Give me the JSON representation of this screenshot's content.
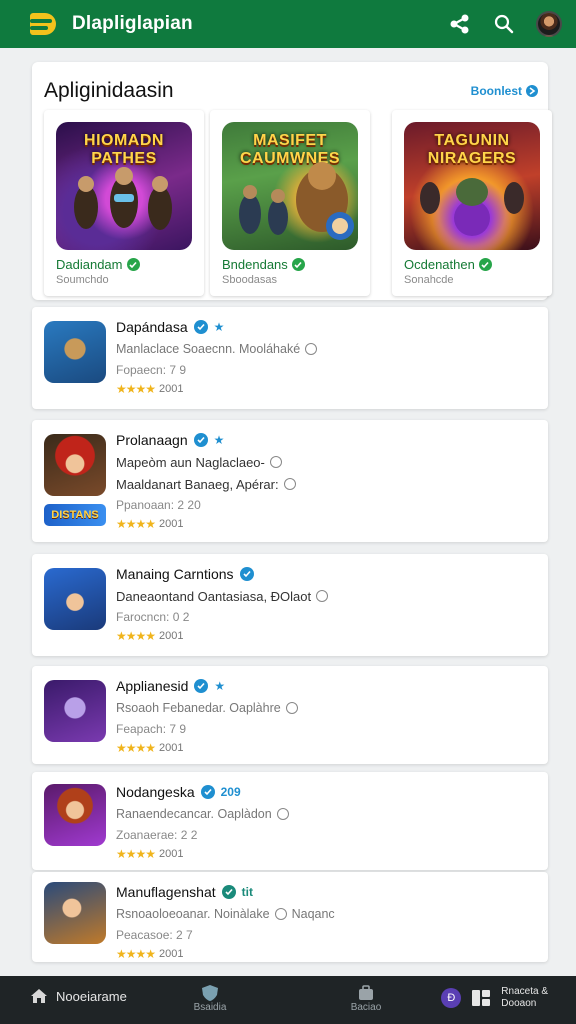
{
  "app": {
    "title": "Dlapliglapian"
  },
  "featured": {
    "title": "Apliginidaasin",
    "link_label": "Boonlest",
    "tiles": [
      {
        "art_title": "HIOMADN PATHES",
        "name": "Dadiandam",
        "sub": "Soumchdo"
      },
      {
        "art_title": "MASIFET CAUMWNES",
        "name": "Bndendans",
        "sub": "Sboodasas"
      },
      {
        "art_title": "TAGUNIN NIRAGERS",
        "name": "Ocdenathen",
        "sub": "Sonahcde"
      }
    ]
  },
  "list": [
    {
      "title": "Dapándasa",
      "lines": [
        "Manlaclace Soaecnn. Mooláhaké",
        "Fopaecn: 7 9"
      ],
      "rating": "2001",
      "chip": ""
    },
    {
      "title": "Prolanaagn",
      "lines": [
        "Mapeòm aun Naglaclaeo-",
        "Maaldanart Banaeg, Apérar:",
        "Ppanoaan: 2 20"
      ],
      "rating": "2001",
      "chip": "DISTANS"
    },
    {
      "title": "Manaing Carntions",
      "lines": [
        "Daneaontand Oantasiasa, ĐOlaot",
        "Farocncn: 0 2"
      ],
      "rating": "2001",
      "chip": ""
    },
    {
      "title": "Applianesid",
      "lines": [
        "Rsoaoh Febanedar. Oaplàhre",
        "Feapach: 7 9"
      ],
      "rating": "2001",
      "chip": ""
    },
    {
      "title": "Nodangeska",
      "lines": [
        "Ranaendecancar. Oaplàdon",
        "Zoanaerae: 2 2"
      ],
      "rating": "2001",
      "chip": ""
    },
    {
      "title": "Manuflagenshat",
      "lines": [
        "Rsnoaoloeoanar. Noinàlake",
        "Peacasoe: 2 7"
      ],
      "rating": "2001",
      "chip": ""
    }
  ],
  "badges": [
    "★",
    "★",
    "★",
    "",
    "209",
    "tit"
  ],
  "extras": [
    "Ò",
    "Ò",
    "Naqanc"
  ],
  "bottom_nav": {
    "home_label": "Nooeiarame",
    "tab1_label": "Bsaidia",
    "tab2_label": "Baciao",
    "right_badge": "Ð",
    "right_line1": "Rnaceta &",
    "right_line2": "Dooaon"
  },
  "colors": {
    "brand": "#0f7a3e",
    "accent": "#1f8fd0",
    "star": "#f0b41c"
  }
}
